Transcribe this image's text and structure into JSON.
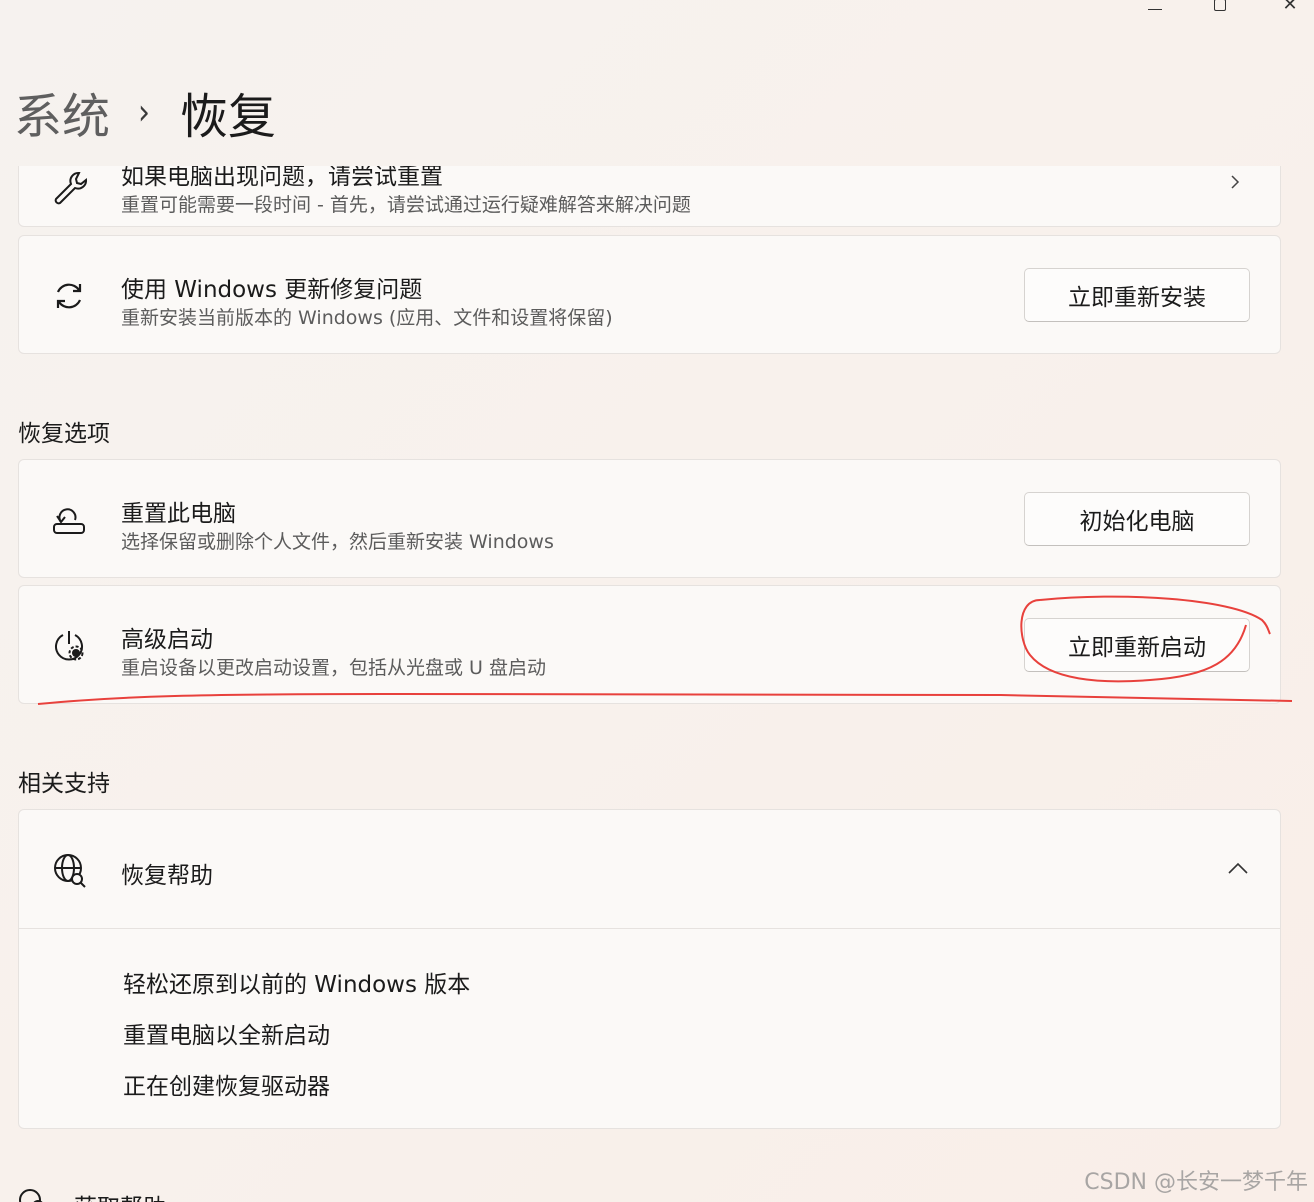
{
  "window": {
    "minimize_glyph": "—",
    "close_glyph": "✕"
  },
  "breadcrumb": {
    "parent": "系统",
    "separator": "›",
    "current": "恢复"
  },
  "top_partial_card": {
    "title": "如果电脑出现问题，请尝试重置",
    "description": "重置可能需要一段时间 - 首先，请尝试通过运行疑难解答来解决问题",
    "icon": "wrench-icon"
  },
  "windows_update_fix": {
    "title": "使用 Windows 更新修复问题",
    "description": "重新安装当前版本的 Windows (应用、文件和设置将保留)",
    "button": "立即重新安装",
    "icon": "sync-icon"
  },
  "recovery_options": {
    "heading": "恢复选项",
    "items": [
      {
        "title": "重置此电脑",
        "description": "选择保留或删除个人文件，然后重新安装 Windows",
        "button": "初始化电脑",
        "icon": "reset-pc-icon"
      },
      {
        "title": "高级启动",
        "description": "重启设备以更改启动设置，包括从光盘或 U 盘启动",
        "button": "立即重新启动",
        "icon": "advanced-startup-icon"
      }
    ]
  },
  "related_support": {
    "heading": "相关支持",
    "help_title": "恢复帮助",
    "links": [
      "轻松还原到以前的 Windows 版本",
      "重置电脑以全新启动",
      "正在创建恢复驱动器"
    ]
  },
  "bottom_partial": {
    "label": "获取帮助"
  },
  "watermark": "CSDN @长安一梦千年",
  "colors": {
    "annotation": "#e8413c",
    "card": "#fbf9f7",
    "border": "#e6e2df"
  }
}
